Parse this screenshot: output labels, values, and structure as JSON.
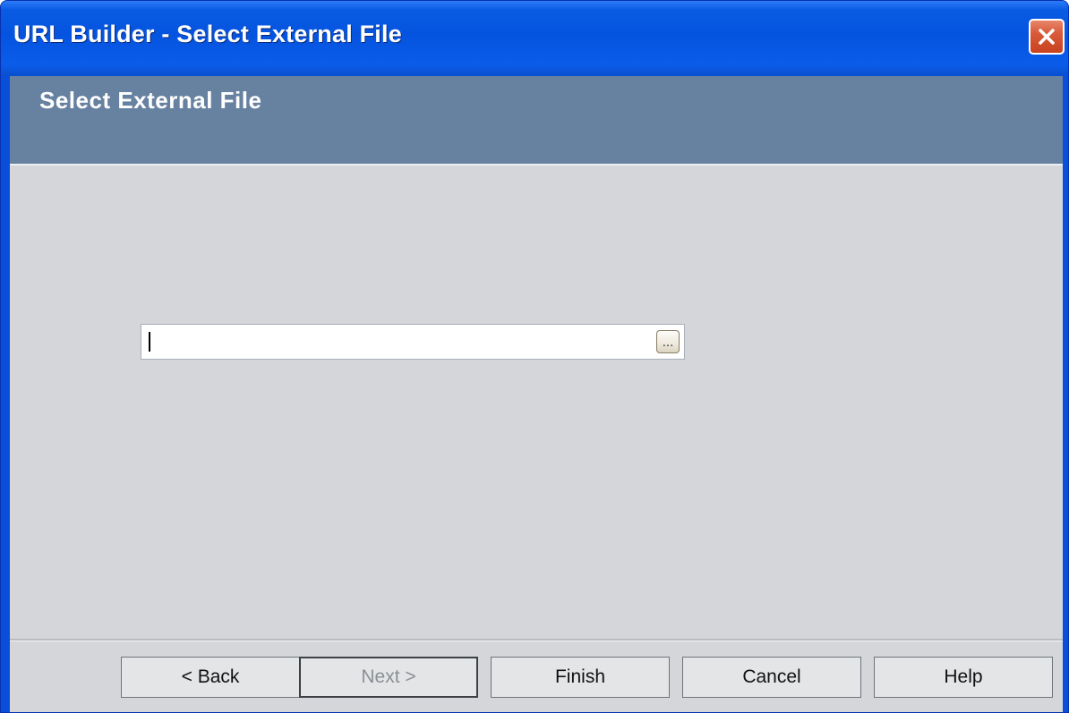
{
  "window": {
    "title": "URL Builder - Select External File"
  },
  "header": {
    "title": "Select External File"
  },
  "file_field": {
    "value": "",
    "browse_label": "..."
  },
  "buttons": {
    "back": "< Back",
    "next": "Next >",
    "finish": "Finish",
    "cancel": "Cancel",
    "help": "Help"
  },
  "colors": {
    "titlebar": "#0554e0",
    "header_panel": "#6781a0",
    "client_background": "#d4d6d9",
    "close_button": "#d85a3a"
  },
  "icons": {
    "close": "close-icon",
    "browse": "ellipsis-icon"
  }
}
